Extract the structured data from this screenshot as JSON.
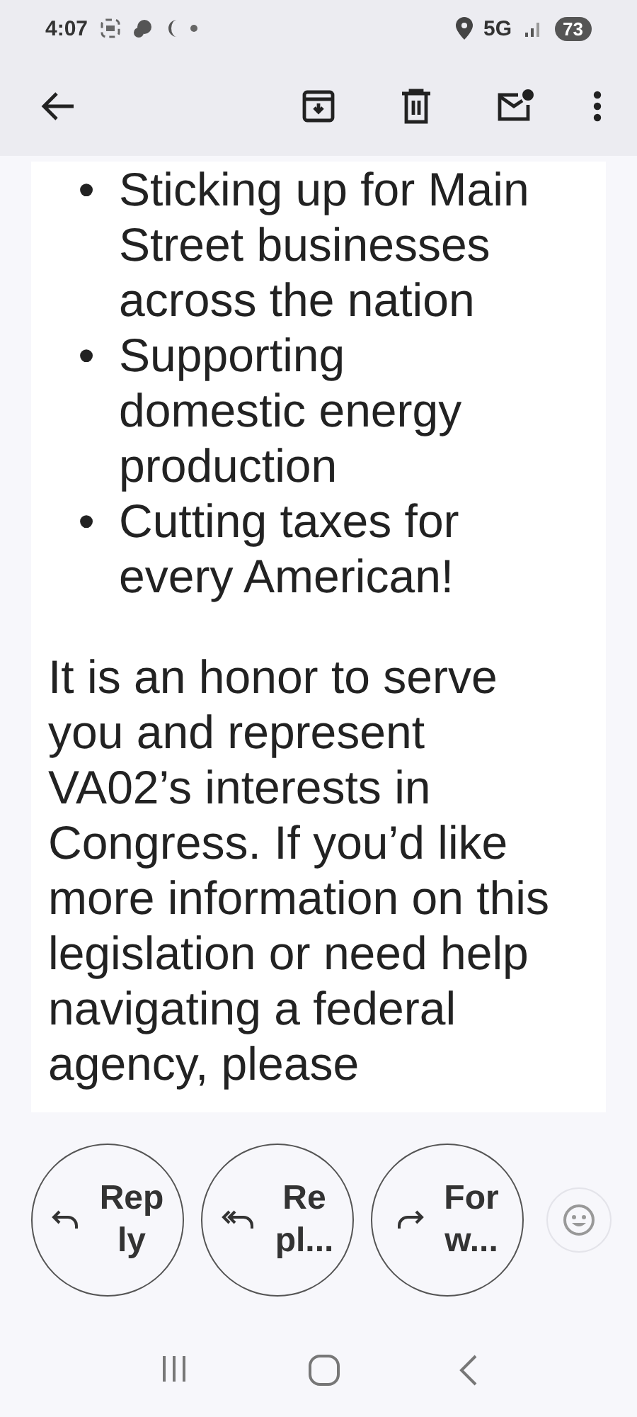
{
  "status_bar": {
    "time": "4:07",
    "network": "5G",
    "battery": "73"
  },
  "bullets": [
    {
      "marker": "•",
      "text": "Sticking up for Main Street businesses across the nation"
    },
    {
      "marker": "•",
      "text": "Supporting domestic energy production"
    },
    {
      "marker": "•",
      "text": "Cutting taxes for every American!"
    }
  ],
  "paragraph": "It is an honor to serve you and represent VA02’s interests in Congress. If you’d like more information on this legislation or need help navigating a federal agency, please",
  "actions": [
    {
      "kind": "reply",
      "lines": [
        "Rep",
        "ly"
      ]
    },
    {
      "kind": "reply_all",
      "lines": [
        "Re",
        "pl..."
      ]
    },
    {
      "kind": "forward",
      "lines": [
        "For",
        "w..."
      ]
    }
  ]
}
